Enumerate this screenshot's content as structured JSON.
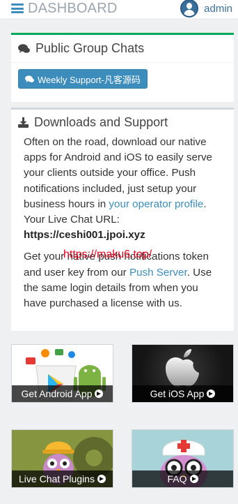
{
  "header": {
    "title": "DASHBOARD",
    "user": "admin"
  },
  "public_chats": {
    "title": "Public Group Chats",
    "button_label": "Weekly Support-凡客源码"
  },
  "downloads": {
    "title": "Downloads and Support",
    "para1_pre": "Often on the road, download our native apps for Android and iOS to easily serve your clients outside your office. Push notifications included, just setup your business hours in ",
    "para1_link": "your operator profile",
    "para1_post": ". Your Live Chat URL:",
    "chat_url": "https://ceshi001.jpoi.xyz",
    "para2_pre": "Get your native push notifications token and user key from our ",
    "para2_link": "Push Server",
    "para2_post": ". Use the same login details from when you have purchased a license with us.",
    "watermark": "https://maku6.top/"
  },
  "tiles": {
    "android": "Get Android App",
    "ios": "Get iOS App",
    "plugins": "Live Chat Plugins",
    "faq": "FAQ"
  },
  "colors": {
    "primary": "#3c8dbc",
    "success_border": "#00a65a",
    "watermark_red": "#e8001c"
  },
  "icons": [
    "hamburger-icon",
    "user-avatar-icon",
    "comments-icon",
    "download-icon",
    "circle-arrow-right-icon"
  ]
}
